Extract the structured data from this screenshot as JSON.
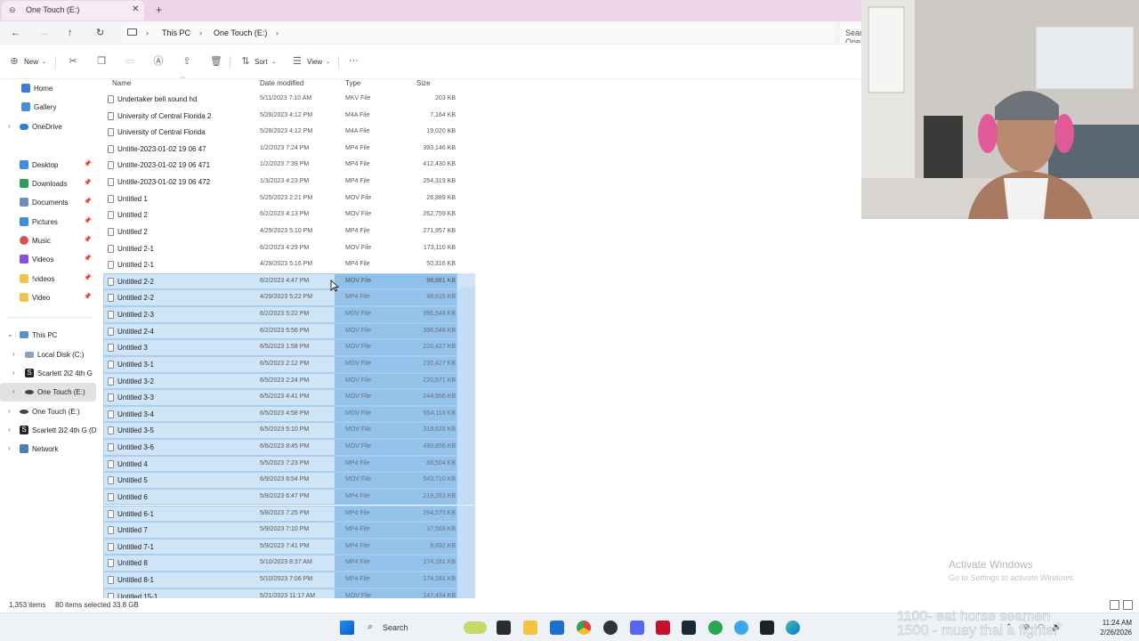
{
  "tab": {
    "title": "One Touch (E:)",
    "close": "✕",
    "add": "+"
  },
  "address": {
    "crumbs": [
      "This PC",
      "One Touch (E:)"
    ],
    "search_placeholder": "Search One Touch (E:)"
  },
  "toolbar": {
    "new_label": "New",
    "sort_label": "Sort",
    "view_label": "View",
    "more_label": "···"
  },
  "sidebar": {
    "items": [
      {
        "label": "Home"
      },
      {
        "label": "Gallery"
      },
      {
        "label": "OneDrive"
      },
      {
        "label": "Desktop"
      },
      {
        "label": "Downloads"
      },
      {
        "label": "Documents"
      },
      {
        "label": "Pictures"
      },
      {
        "label": "Music"
      },
      {
        "label": "Videos"
      },
      {
        "label": "!videos"
      },
      {
        "label": "Video"
      },
      {
        "label": "This PC"
      },
      {
        "label": "Local Disk (C:)"
      },
      {
        "label": "Scarlett 2i2 4th G"
      },
      {
        "label": "One Touch (E:)"
      },
      {
        "label": "One Touch (E:)"
      },
      {
        "label": "Scarlett 2i2 4th G (D"
      },
      {
        "label": "Network"
      }
    ]
  },
  "columns": {
    "name": "Name",
    "date": "Date modified",
    "type": "Type",
    "size": "Size"
  },
  "files": [
    {
      "name": "Undertaker bell sound hd",
      "date": "5/11/2023 7:10 AM",
      "type": "MKV File",
      "size": "203 KB",
      "sel": false
    },
    {
      "name": "University of Central Florida 2",
      "date": "5/28/2023 4:12 PM",
      "type": "M4A File",
      "size": "7,164 KB",
      "sel": false
    },
    {
      "name": "University of Central Florida",
      "date": "5/28/2023 4:12 PM",
      "type": "M4A File",
      "size": "19,020 KB",
      "sel": false
    },
    {
      "name": "Untitle-2023-01-02 19 06 47",
      "date": "1/2/2023 7:24 PM",
      "type": "MP4 File",
      "size": "393,146 KB",
      "sel": false
    },
    {
      "name": "Untitle-2023-01-02 19 06 471",
      "date": "1/2/2023 7:39 PM",
      "type": "MP4 File",
      "size": "412,430 KB",
      "sel": false
    },
    {
      "name": "Untitle-2023-01-02 19 06 472",
      "date": "1/3/2023 4:23 PM",
      "type": "MP4 File",
      "size": "254,319 KB",
      "sel": false
    },
    {
      "name": "Untitled 1",
      "date": "5/25/2023 2:21 PM",
      "type": "MOV File",
      "size": "26,889 KB",
      "sel": false
    },
    {
      "name": "Untitled 2",
      "date": "6/2/2023 4:13 PM",
      "type": "MOV File",
      "size": "262,759 KB",
      "sel": false
    },
    {
      "name": "Untitled 2",
      "date": "4/29/2023 5:10 PM",
      "type": "MP4 File",
      "size": "271,957 KB",
      "sel": false
    },
    {
      "name": "Untitled 2-1",
      "date": "6/2/2023 4:29 PM",
      "type": "MOV File",
      "size": "173,110 KB",
      "sel": false
    },
    {
      "name": "Untitled 2-1",
      "date": "4/29/2023 5:16 PM",
      "type": "MP4 File",
      "size": "50,316 KB",
      "sel": false
    },
    {
      "name": "Untitled 2-2",
      "date": "6/2/2023 4:47 PM",
      "type": "MOV File",
      "size": "98,881 KB",
      "sel": true
    },
    {
      "name": "Untitled 2-2",
      "date": "4/29/2023 5:22 PM",
      "type": "MP4 File",
      "size": "48,615 KB",
      "sel": true
    },
    {
      "name": "Untitled 2-3",
      "date": "6/2/2023 5:22 PM",
      "type": "MOV File",
      "size": "396,548 KB",
      "sel": true
    },
    {
      "name": "Untitled 2-4",
      "date": "6/2/2023 5:56 PM",
      "type": "MOV File",
      "size": "396,548 KB",
      "sel": true
    },
    {
      "name": "Untitled 3",
      "date": "6/5/2023 1:58 PM",
      "type": "MOV File",
      "size": "220,427 KB",
      "sel": true
    },
    {
      "name": "Untitled 3-1",
      "date": "6/5/2023 2:12 PM",
      "type": "MOV File",
      "size": "220,427 KB",
      "sel": true
    },
    {
      "name": "Untitled 3-2",
      "date": "6/5/2023 2:24 PM",
      "type": "MOV File",
      "size": "220,571 KB",
      "sel": true
    },
    {
      "name": "Untitled 3-3",
      "date": "6/5/2023 4:41 PM",
      "type": "MOV File",
      "size": "244,556 KB",
      "sel": true
    },
    {
      "name": "Untitled 3-4",
      "date": "6/5/2023 4:58 PM",
      "type": "MOV File",
      "size": "654,115 KB",
      "sel": true
    },
    {
      "name": "Untitled 3-5",
      "date": "6/5/2023 5:10 PM",
      "type": "MOV File",
      "size": "319,626 KB",
      "sel": true
    },
    {
      "name": "Untitled 3-6",
      "date": "6/6/2023 8:45 PM",
      "type": "MOV File",
      "size": "493,856 KB",
      "sel": true
    },
    {
      "name": "Untitled 4",
      "date": "5/5/2023 7:23 PM",
      "type": "MP4 File",
      "size": "88,504 KB",
      "sel": true
    },
    {
      "name": "Untitled 5",
      "date": "6/9/2023 6:54 PM",
      "type": "MOV File",
      "size": "543,710 KB",
      "sel": true
    },
    {
      "name": "Untitled 6",
      "date": "5/8/2023 6:47 PM",
      "type": "MP4 File",
      "size": "219,253 KB",
      "sel": true
    },
    {
      "name": "Untitled 6-1",
      "date": "5/8/2023 7:25 PM",
      "type": "MP4 File",
      "size": "264,575 KB",
      "sel": true
    },
    {
      "name": "Untitled 7",
      "date": "5/9/2023 7:10 PM",
      "type": "MP4 File",
      "size": "37,569 KB",
      "sel": true
    },
    {
      "name": "Untitled 7-1",
      "date": "5/9/2023 7:41 PM",
      "type": "MP4 File",
      "size": "9,692 KB",
      "sel": true
    },
    {
      "name": "Untitled 8",
      "date": "5/10/2023 8:37 AM",
      "type": "MP4 File",
      "size": "174,181 KB",
      "sel": true
    },
    {
      "name": "Untitled 8-1",
      "date": "5/10/2023 7:06 PM",
      "type": "MP4 File",
      "size": "174,181 KB",
      "sel": true
    },
    {
      "name": "Untitled 15-1",
      "date": "5/21/2023 11:17 AM",
      "type": "MOV File",
      "size": "147,434 KB",
      "sel": true
    }
  ],
  "status": {
    "count": "1,353 items",
    "selected": "80 items selected  33.8 GB"
  },
  "watermark": {
    "line1": "Activate Windows",
    "line2": "Go to Settings to activate Windows."
  },
  "overlay": {
    "line1": "1100- eat horse seamen",
    "line2": "1500 - muay thai a fighter"
  },
  "taskbar": {
    "search_label": "Search",
    "time": "11:24 AM",
    "date": "2/26/2026"
  },
  "colors": {
    "accent": "#0067c0",
    "selection": "#cfe4f7",
    "selection_strong": "#8fc0ea",
    "tabbar": "#ecd5e8"
  }
}
